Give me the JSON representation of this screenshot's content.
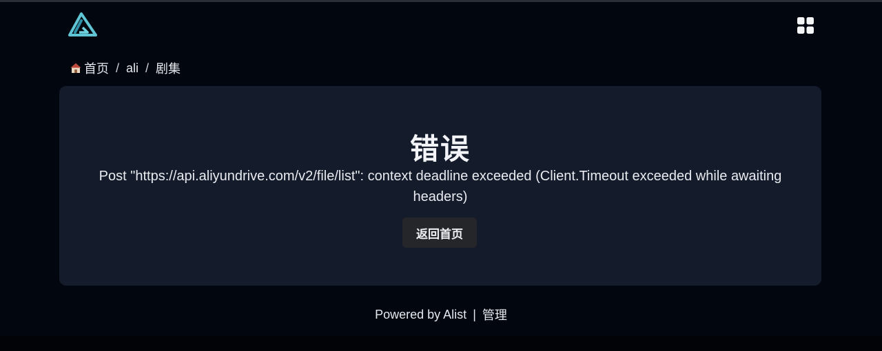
{
  "header": {
    "logo_icon": "alist-logo-icon",
    "apps_icon": "grid-apps-icon"
  },
  "breadcrumb": {
    "home_icon": "house-icon",
    "items": [
      {
        "label": "首页"
      },
      {
        "label": "ali"
      },
      {
        "label": "剧集"
      }
    ],
    "separator": "/"
  },
  "error": {
    "title": "错误",
    "message": "Post \"https://api.aliyundrive.com/v2/file/list\": context deadline exceeded (Client.Timeout exceeded while awaiting headers)",
    "back_button_label": "返回首页"
  },
  "footer": {
    "powered_text": "Powered by Alist",
    "divider": "|",
    "manage_link": "管理"
  },
  "colors": {
    "background": "#02060f",
    "card": "#141b2b",
    "logo_accent": "#5fc4d4",
    "button_bg": "#252629"
  }
}
